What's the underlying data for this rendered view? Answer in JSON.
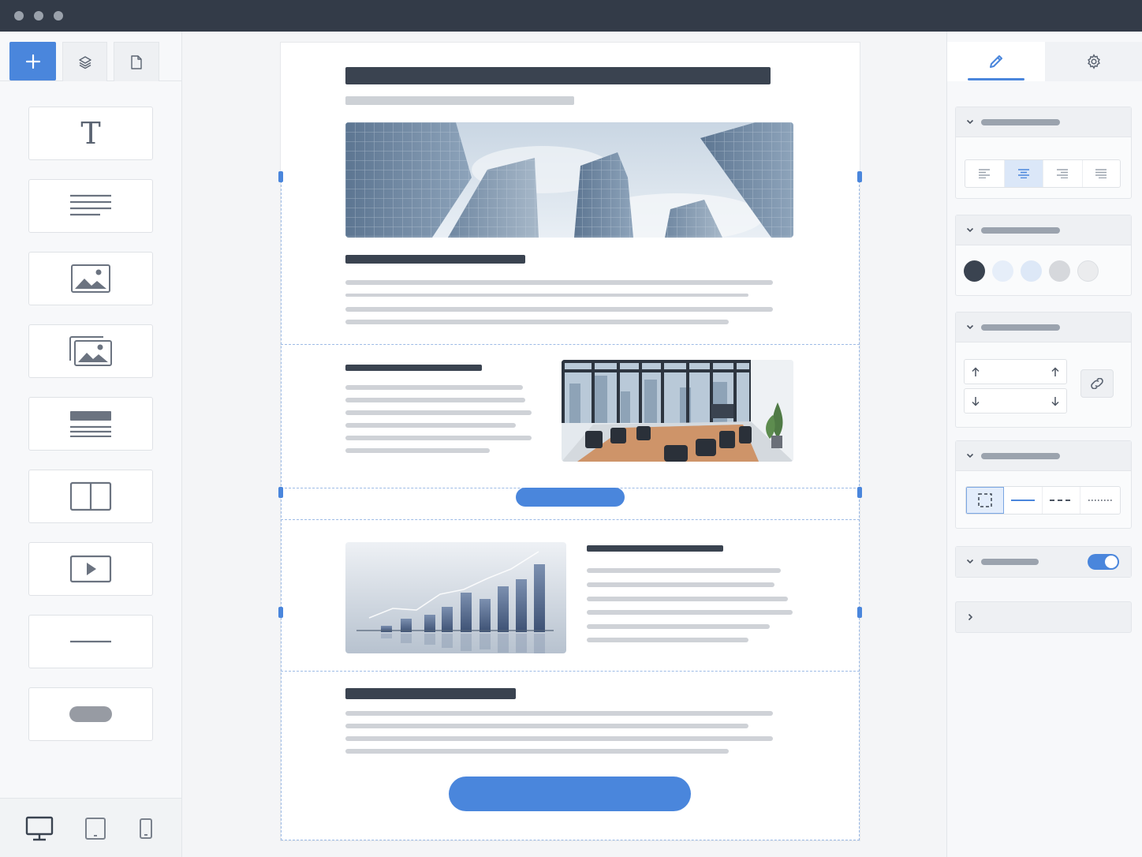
{
  "window": {
    "controls": [
      "close-dot",
      "minimize-dot",
      "zoom-dot"
    ]
  },
  "left_panel": {
    "tabs": [
      {
        "icon": "plus-icon",
        "active": true
      },
      {
        "icon": "layers-icon",
        "active": false
      },
      {
        "icon": "page-icon",
        "active": false
      }
    ],
    "blocks": [
      {
        "icon": "text-icon",
        "glyph": "T"
      },
      {
        "icon": "paragraph-icon"
      },
      {
        "icon": "image-icon"
      },
      {
        "icon": "gallery-icon"
      },
      {
        "icon": "heading-text-icon"
      },
      {
        "icon": "columns-icon"
      },
      {
        "icon": "video-icon"
      },
      {
        "icon": "divider-icon"
      },
      {
        "icon": "button-block-icon"
      }
    ],
    "devices": [
      "desktop-icon",
      "tablet-icon",
      "mobile-icon"
    ]
  },
  "right_panel": {
    "tabs": [
      {
        "icon": "pencil-icon",
        "active": true
      },
      {
        "icon": "gear-icon",
        "active": false
      }
    ],
    "alignment": {
      "options": [
        "align-left",
        "align-center",
        "align-right",
        "align-justify"
      ],
      "selected": "align-center"
    },
    "color_swatches": [
      "#3a4350",
      "#e6eef9",
      "#dde8f7",
      "#d6d8dc",
      "#ebecee"
    ],
    "border_styles": {
      "options": [
        "none",
        "solid",
        "dashed",
        "dotted"
      ],
      "selected": "none"
    },
    "toggle_on": true
  },
  "colors": {
    "accent": "#4a86dc",
    "titlebar": "#333b48",
    "text_dark": "#3a4350"
  }
}
